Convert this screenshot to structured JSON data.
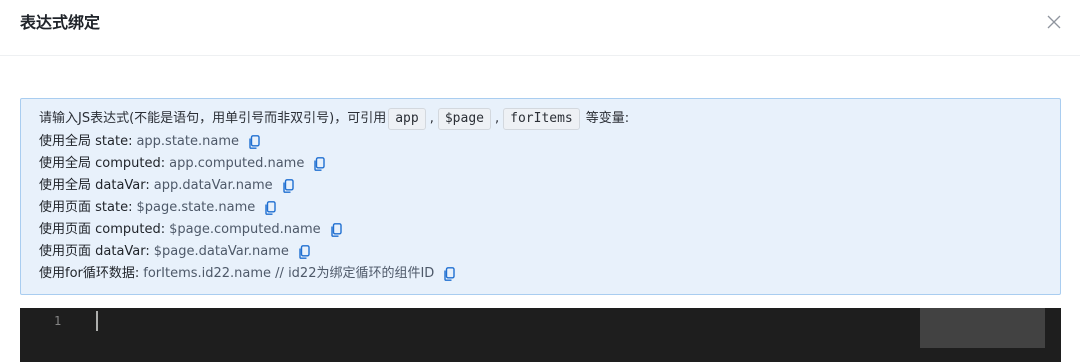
{
  "dialog": {
    "title": "表达式绑定"
  },
  "tip": {
    "intro_prefix": "请输入JS表达式(不能是语句，用单引号而非双引号)，可引用",
    "vars": [
      "app",
      "$page",
      "forItems"
    ],
    "separator": ",",
    "intro_suffix": "等变量:",
    "examples": [
      {
        "label": "使用全局 state:",
        "expr": "app.state.name"
      },
      {
        "label": "使用全局 computed:",
        "expr": "app.computed.name"
      },
      {
        "label": "使用全局 dataVar:",
        "expr": "app.dataVar.name"
      },
      {
        "label": "使用页面 state:",
        "expr": "$page.state.name"
      },
      {
        "label": "使用页面 computed:",
        "expr": "$page.computed.name"
      },
      {
        "label": "使用页面 dataVar:",
        "expr": "$page.dataVar.name"
      },
      {
        "label": "使用for循环数据:",
        "expr": "forItems.id22.name // id22为绑定循环的组件ID"
      }
    ]
  },
  "editor": {
    "line_number": "1",
    "value": ""
  },
  "icons": {
    "close": "close-icon",
    "copy": "copy-icon"
  },
  "colors": {
    "tip_bg": "#e8f1fb",
    "tip_border": "#a9cdf0",
    "editor_bg": "#1e1e1e",
    "icon_blue": "#1f6fd1"
  }
}
